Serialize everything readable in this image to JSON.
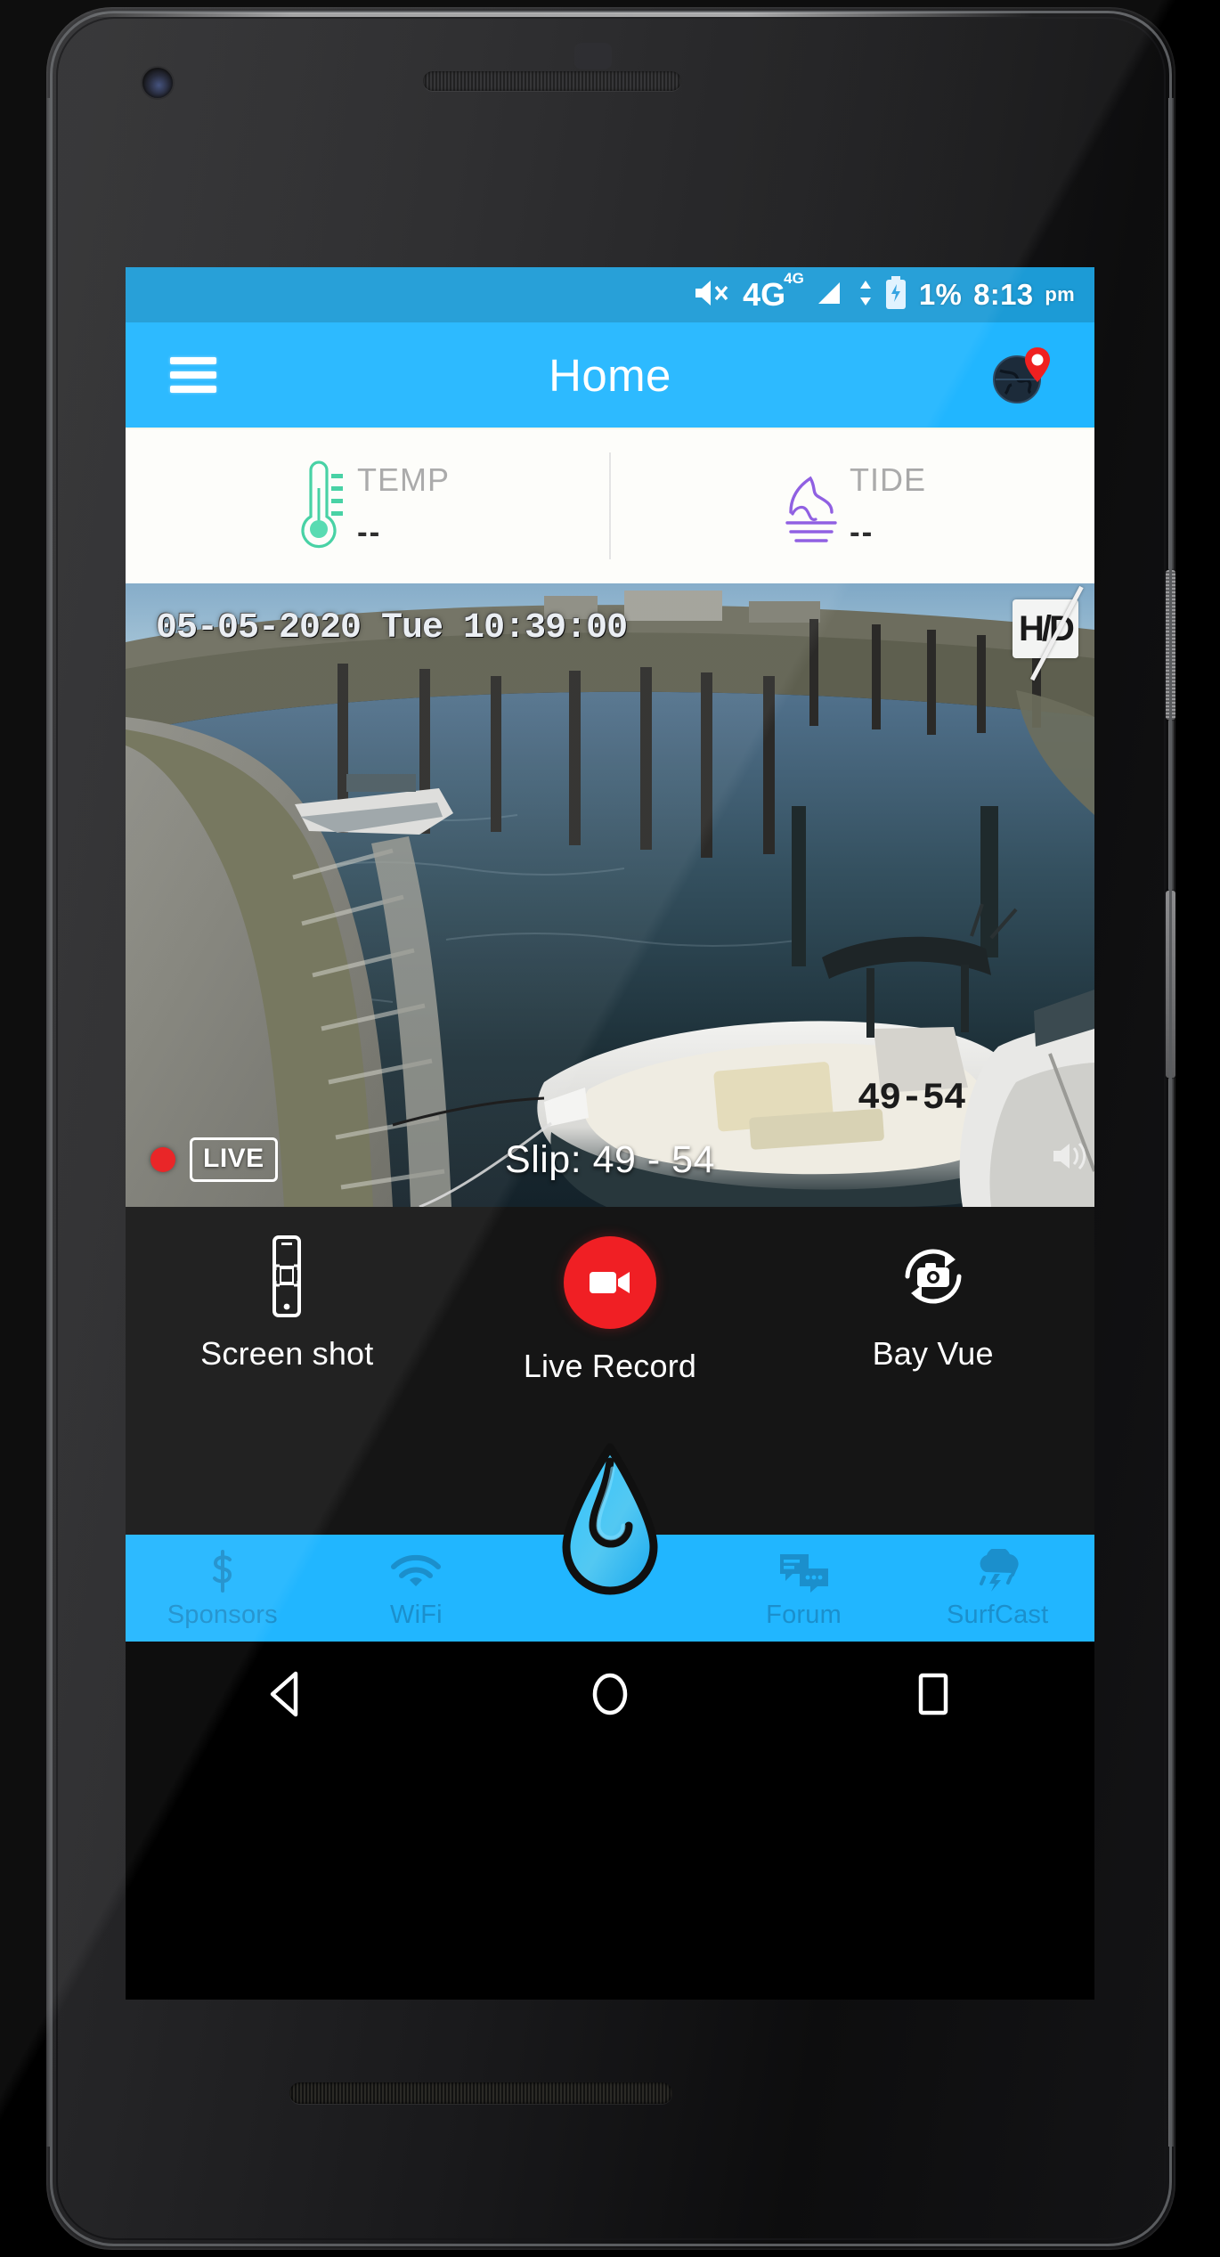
{
  "statusbar": {
    "mute_icon": "speaker-mute-icon",
    "network_label": "4G",
    "network_sup": "4G",
    "signal_icon": "signal-bars-icon",
    "data_arrows_icon": "data-transfer-icon",
    "battery_icon": "battery-charging-icon",
    "battery_percent": "1%",
    "time": "8:13",
    "time_suffix": "pm"
  },
  "appbar": {
    "menu_icon": "hamburger-menu-icon",
    "title": "Home",
    "globe_icon": "globe-location-pin-icon"
  },
  "meta": {
    "cells": [
      {
        "label": "TEMP",
        "value": "--",
        "icon": "thermometer-icon",
        "color": "#3ecfa0"
      },
      {
        "label": "TIDE",
        "value": "--",
        "icon": "tide-wave-icon",
        "color": "#8a57e0"
      }
    ]
  },
  "camera": {
    "timestamp": "05-05-2020 Tue 10:39:00",
    "hd_badge": "H/D",
    "hd_state": "disabled",
    "slip_overlay_number": "49-54",
    "live_label": "LIVE",
    "live_indicator": "recording-dot",
    "slip_label": "Slip: 49 - 54",
    "volume_icon": "volume-icon"
  },
  "actions": [
    {
      "label": "Screen shot",
      "icon": "phone-screenshot-icon"
    },
    {
      "label": "Live Record",
      "icon": "video-record-icon",
      "accent": "#f01f24"
    },
    {
      "label": "Bay Vue",
      "icon": "camera-rotate-icon"
    }
  ],
  "bottomnav": {
    "items": [
      {
        "label": "Sponsors",
        "icon": "dollar-sign-icon"
      },
      {
        "label": "WiFi",
        "icon": "wifi-icon"
      },
      {
        "label": "",
        "icon": "water-drop-logo"
      },
      {
        "label": "Forum",
        "icon": "chat-bubbles-icon"
      },
      {
        "label": "SurfCast",
        "icon": "storm-cloud-icon"
      }
    ]
  },
  "androidnav": {
    "back": "back-triangle-icon",
    "home": "home-circle-icon",
    "recents": "recents-square-icon"
  },
  "colors": {
    "statusbar_blue": "#1c9bd6",
    "appbar_blue": "#21b6ff",
    "record_red": "#f01f24",
    "nav_label_blue": "#1b8fcc"
  }
}
